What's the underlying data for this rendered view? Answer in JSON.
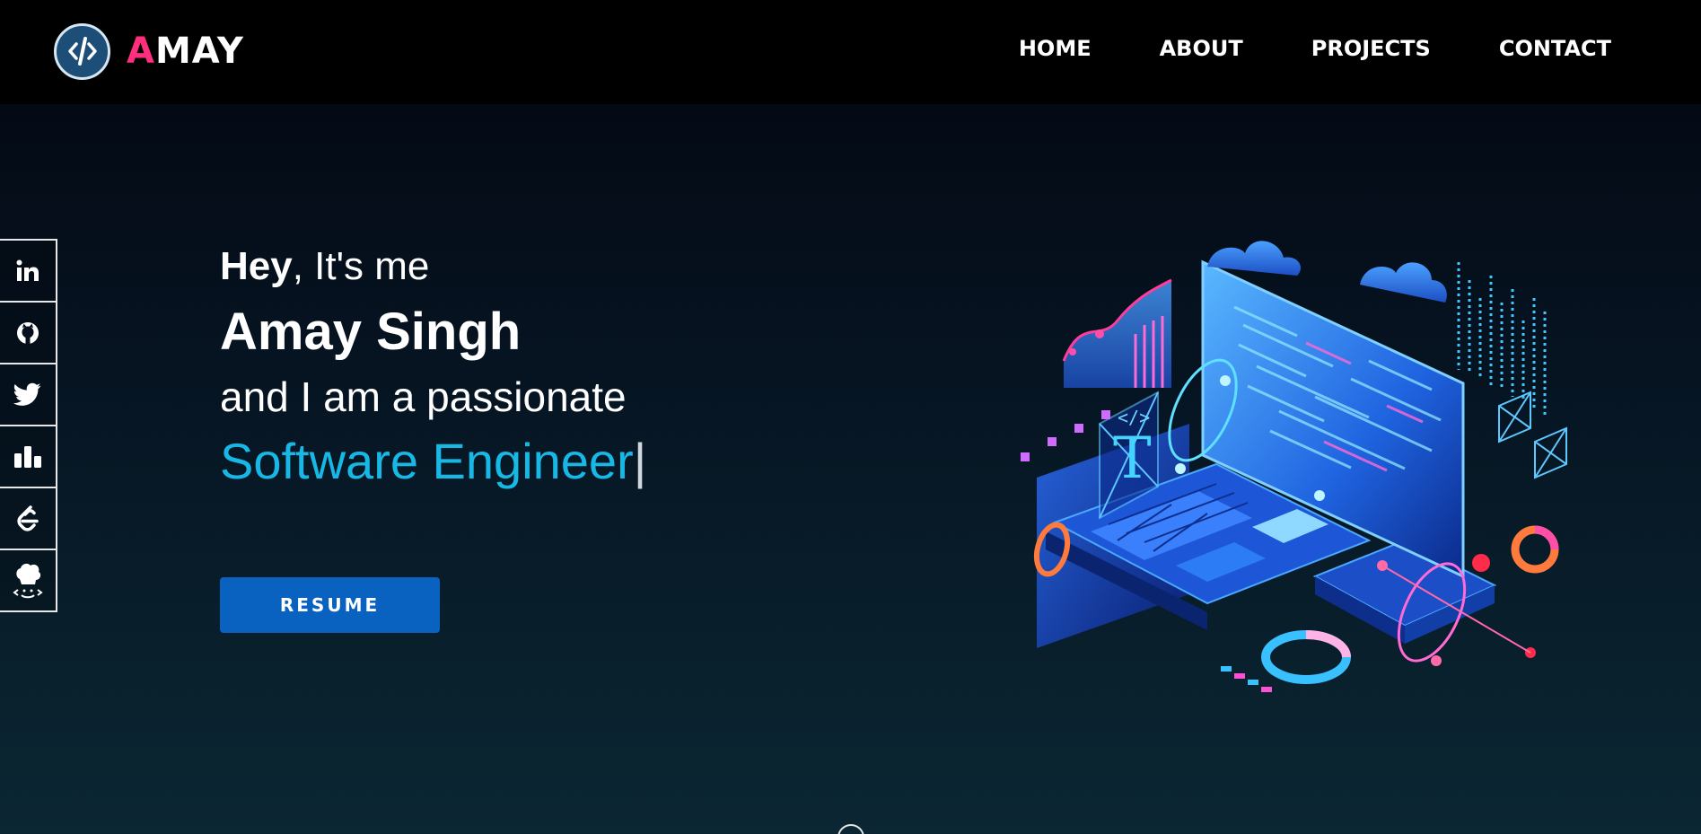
{
  "brand": {
    "first_letter": "A",
    "rest": "MAY",
    "logo_icon": "code-slash-icon",
    "accent": "#ff2e7e"
  },
  "nav": {
    "items": [
      {
        "label": "HOME"
      },
      {
        "label": "ABOUT"
      },
      {
        "label": "PROJECTS"
      },
      {
        "label": "CONTACT"
      }
    ]
  },
  "social": {
    "items": [
      {
        "icon": "linkedin-icon"
      },
      {
        "icon": "github-icon"
      },
      {
        "icon": "twitter-icon"
      },
      {
        "icon": "bar-chart-icon"
      },
      {
        "icon": "leetcode-icon"
      },
      {
        "icon": "codechef-icon"
      }
    ]
  },
  "hero": {
    "greeting_bold": "Hey",
    "greeting_rest": ", It's me",
    "name": "Amay Singh",
    "tagline": "and I am a passionate",
    "role": "Software Engineer",
    "cursor": "|",
    "resume_label": "RESUME",
    "role_color": "#17b8e6",
    "button_color": "#0a62c0"
  },
  "illustration": {
    "description_icon": "isometric-computer-illustration",
    "code_tag": "</>",
    "letter": "T"
  }
}
